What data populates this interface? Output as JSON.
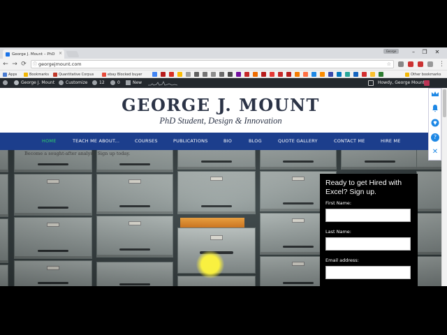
{
  "browser": {
    "tab_title": "George J. Mount – PhD",
    "tab_close": "×",
    "profile_label": "George",
    "window_controls": [
      "–",
      "❐",
      "✕"
    ],
    "nav_back": "←",
    "nav_forward": "→",
    "nav_reload": "⟳",
    "url": "georgejmount.com",
    "lock_icon": "ⓘ",
    "star_icon": "☆",
    "menu": "⋮",
    "bookmarks": [
      {
        "label": "Apps",
        "color": "#4a7bd0"
      },
      {
        "label": "Bookmarks",
        "color": "#f2b705"
      },
      {
        "label": "Quantitative Corpus",
        "color": "#c0392b"
      },
      {
        "label": "ebay Blocked buyer",
        "color": "#e74c3c"
      }
    ],
    "other_bookmarks": "Other bookmarks"
  },
  "wp_admin_bar": {
    "site_name": "George J. Mount",
    "customize": "Customize",
    "updates_count": "12",
    "comments_count": "0",
    "new_label": "New",
    "howdy": "Howdy, George Mount"
  },
  "site": {
    "title": "GEORGE J. MOUNT",
    "tagline": "PhD Student, Design & Innovation",
    "nav": [
      {
        "label": "HOME",
        "active": true
      },
      {
        "label": "TEACH ME ABOUT...",
        "active": false
      },
      {
        "label": "COURSES",
        "active": false
      },
      {
        "label": "PUBLICATIONS",
        "active": false
      },
      {
        "label": "BIO",
        "active": false
      },
      {
        "label": "BLOG",
        "active": false
      },
      {
        "label": "QUOTE GALLERY",
        "active": false
      },
      {
        "label": "CONTACT ME",
        "active": false
      },
      {
        "label": "HIRE ME",
        "active": false
      }
    ],
    "active_nav_color": "#2fd36a",
    "nav_bg_color": "#1c3e8c"
  },
  "hero": {
    "text": "Become a sought-after analyst. Sign up today."
  },
  "signup": {
    "headline": "Ready to get Hired with Excel? Sign up.",
    "fields": [
      {
        "label": "First Name:",
        "value": ""
      },
      {
        "label": "Last Name:",
        "value": ""
      },
      {
        "label": "Email address:",
        "value": ""
      }
    ]
  },
  "float_panel": {
    "icons": [
      "crown-icon",
      "bell-icon",
      "diamond-icon",
      "help-icon",
      "close-icon"
    ],
    "close_glyph": "✕",
    "help_glyph": "?"
  }
}
